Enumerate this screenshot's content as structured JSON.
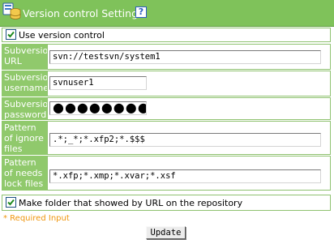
{
  "header": {
    "title": "Version control Settings",
    "help_icon": "?",
    "icon": "database-icon"
  },
  "use_version_control": {
    "label": "Use version control",
    "checked": true
  },
  "fields": {
    "url": {
      "label": "Subversion URL",
      "value": "svn://testsvn/system1"
    },
    "username": {
      "label": "Subversion username",
      "value": "svnuser1"
    },
    "password": {
      "label": "Subversion password",
      "value": "●●●●●●●●"
    },
    "ignore": {
      "label": "Pattern of ignore files",
      "value": ".*;_*;*.xfp2;*.$$$"
    },
    "lock": {
      "label": "Pattern of needs lock files",
      "value": "*.xfp;*.xmp;*.xvar;*.xsf"
    }
  },
  "make_folder": {
    "label": "Make folder that showed by URL on the repository",
    "checked": true
  },
  "required_note": "* Required Input",
  "update_button": "Update",
  "colors": {
    "header_bg": "#7fc25a",
    "label_bg": "#90c96c",
    "border": "#8fc270",
    "required": "#f0960e"
  }
}
